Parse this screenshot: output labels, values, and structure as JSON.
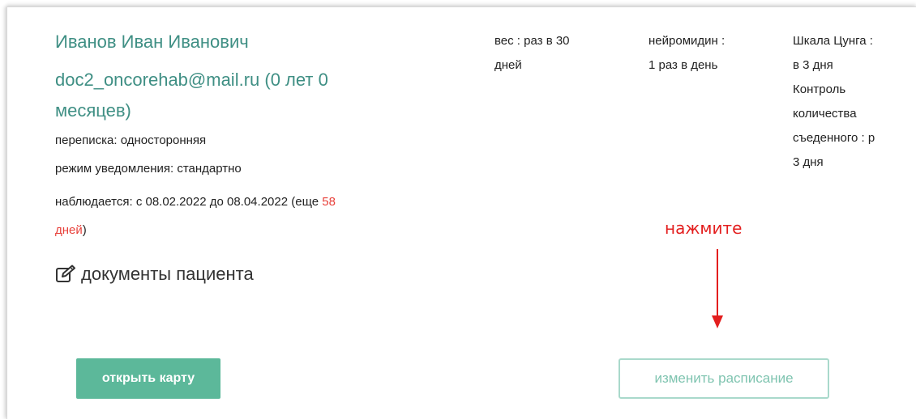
{
  "patient": {
    "name": "Иванов Иван Иванович",
    "contact_line1": "doc2_oncorehab@mail.ru (0 лет 0",
    "contact_line2": "месяцев)",
    "correspondence": "переписка: односторонняя",
    "notification_mode": "режим уведомления: стандартно",
    "observed_prefix": "наблюдается: с 08.02.2022 до 08.04.2022 (еще ",
    "observed_days": "58",
    "observed_days_word": "дней",
    "observed_suffix": ")"
  },
  "documents": {
    "label": "документы пациента",
    "icon": "edit-icon"
  },
  "schedule": {
    "col1": [
      "вес : раз в 30",
      "дней"
    ],
    "col2": [
      "нейромидин :",
      "1 раз в день"
    ],
    "col3": [
      "Шкала Цунга :",
      "в 3 дня",
      "Контроль",
      "количества",
      "съеденного : р",
      "3 дня"
    ]
  },
  "annotation": {
    "hint": "нажмите"
  },
  "buttons": {
    "open_card": "открыть карту",
    "change_schedule": "изменить расписание"
  },
  "colors": {
    "accent": "#3f8f84",
    "button_green": "#5cb89a",
    "highlight_red": "#e8403a",
    "annotation_red": "#e31e1e"
  }
}
